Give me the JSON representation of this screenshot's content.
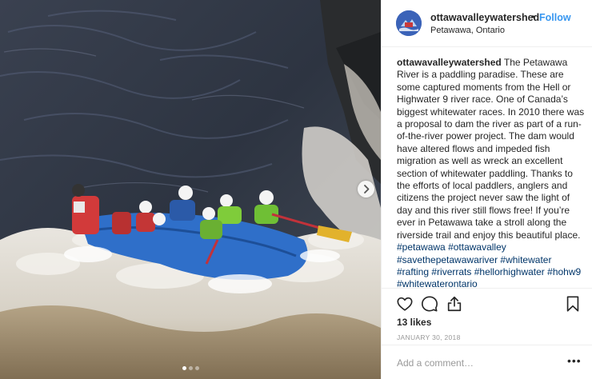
{
  "post": {
    "username": "ottawavalleywatershed",
    "follow_label": "Follow",
    "separator": "•",
    "location": "Petawawa, Ontario",
    "caption_username": "ottawavalleywatershed",
    "caption_text": "The Petawawa River is a paddling paradise. These are some captured moments from the Hell or Highwater 9 river race. One of Canada’s biggest whitewater races. In 2010 there was a proposal to dam the river as part of a run-of-the-river power project. The dam would have altered flows and impeded fish migration as well as wreck an excellent section of whitewater paddling. Thanks to the efforts of local paddlers, anglers and citizens the project never saw the light of day and this river still flows free! If you’re ever in Petawawa take a stroll along the riverside trail and enjoy this beautiful place.",
    "hashtags": [
      "#petawawa",
      "#ottawavalley",
      "#savethepetawawariver",
      "#whitewater",
      "#rafting",
      "#riverrats",
      "#hellorhighwater",
      "#hohw9",
      "#whitewaterontario"
    ],
    "likes": "13 likes",
    "date": "JANUARY 30, 2018",
    "comment_placeholder": "Add a comment…",
    "more_label": "•••"
  },
  "icons": {
    "like": "heart-icon",
    "comment": "comment-bubble-icon",
    "share": "share-icon",
    "save": "bookmark-icon",
    "next": "chevron-right-icon"
  },
  "carousel": {
    "slides": 3,
    "active_index": 0
  },
  "colors": {
    "link": "#3897f0",
    "hashtag": "#003569",
    "text": "#262626",
    "muted": "#999999",
    "border": "#efefef"
  }
}
